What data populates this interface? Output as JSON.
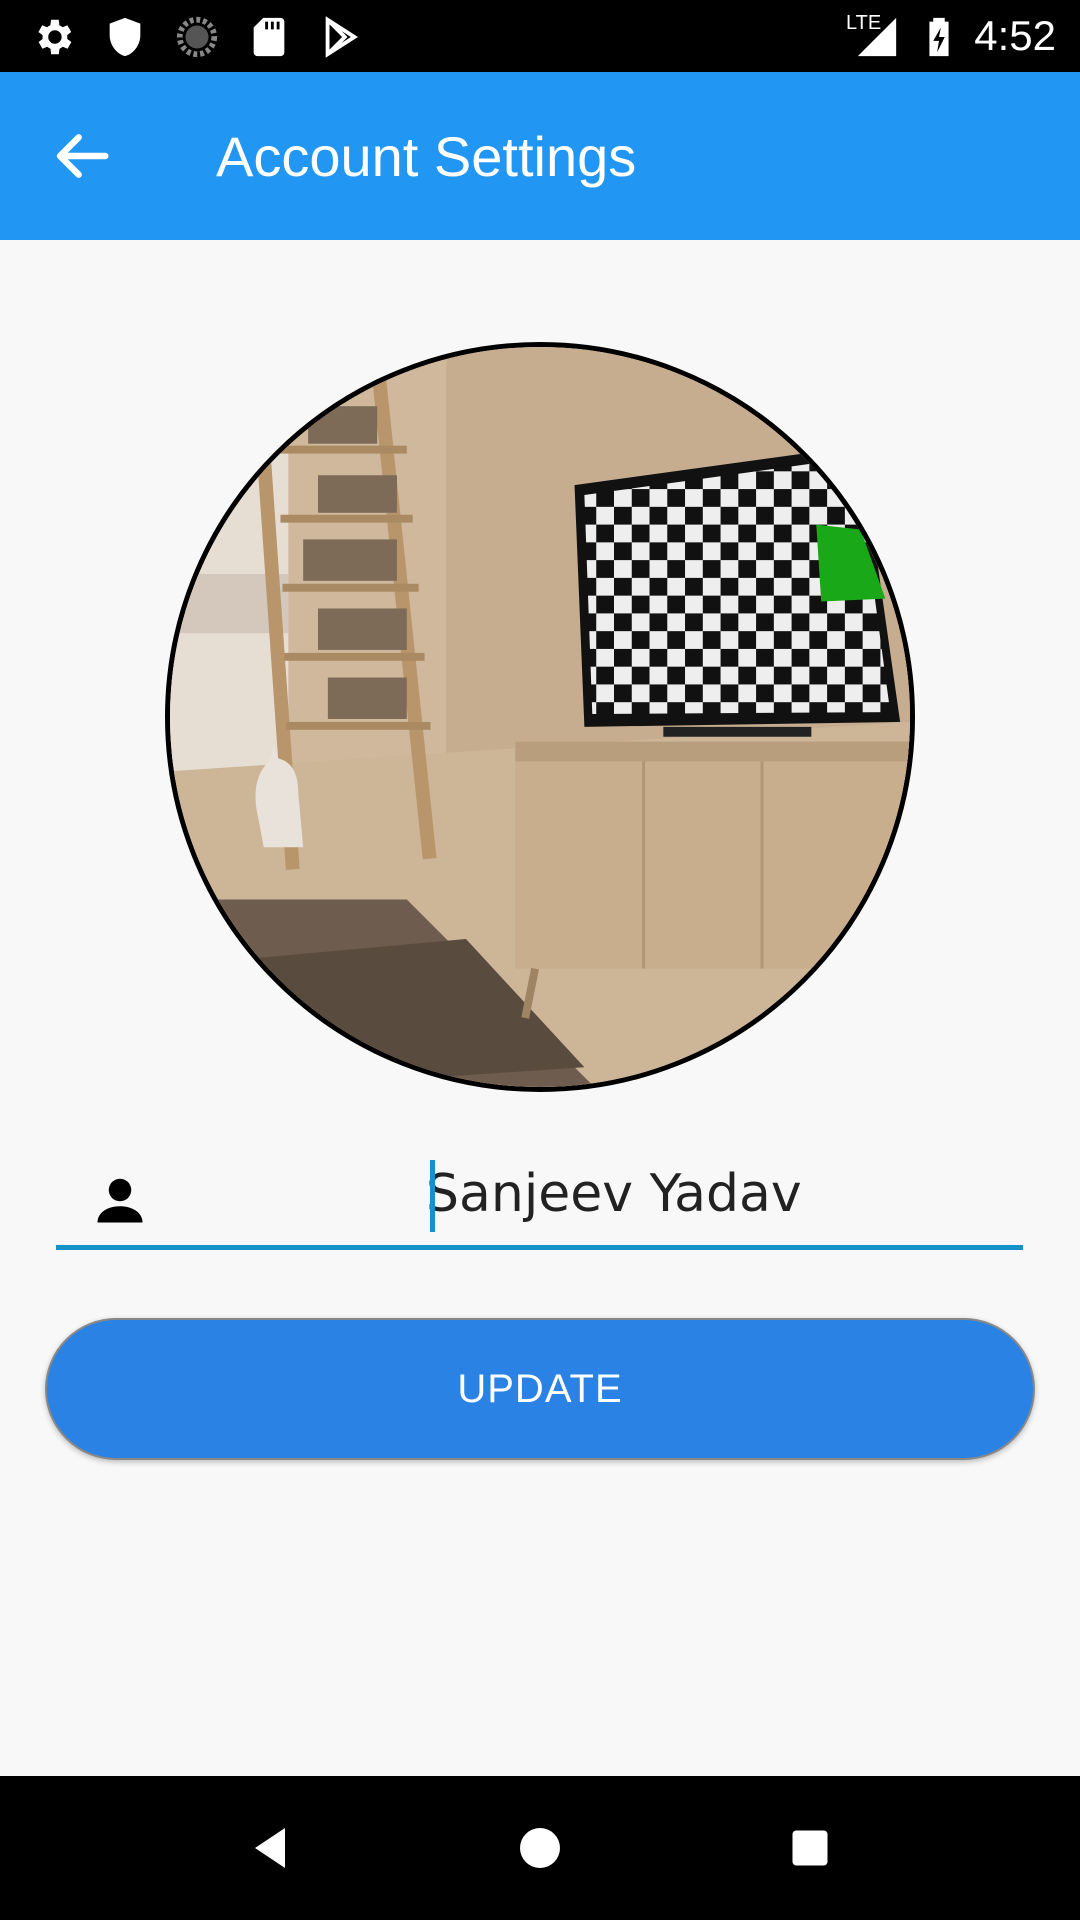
{
  "status_bar": {
    "time": "4:52",
    "network_label": "LTE",
    "icons": [
      "settings-icon",
      "shield-icon",
      "sync-icon",
      "sd-card-icon",
      "play-store-icon",
      "signal-icon",
      "battery-charging-icon"
    ]
  },
  "app_bar": {
    "title": "Account Settings",
    "back_icon": "arrow-back-icon"
  },
  "profile": {
    "name_value": "Sanjeev Yadav",
    "field_icon": "person-icon"
  },
  "actions": {
    "update_label": "UPDATE"
  },
  "nav_bar": {
    "icons": [
      "back-triangle-icon",
      "home-circle-icon",
      "recents-square-icon"
    ]
  },
  "colors": {
    "app_bar": "#2196f3",
    "button": "#2a82e4",
    "field_underline": "#1592c8"
  }
}
